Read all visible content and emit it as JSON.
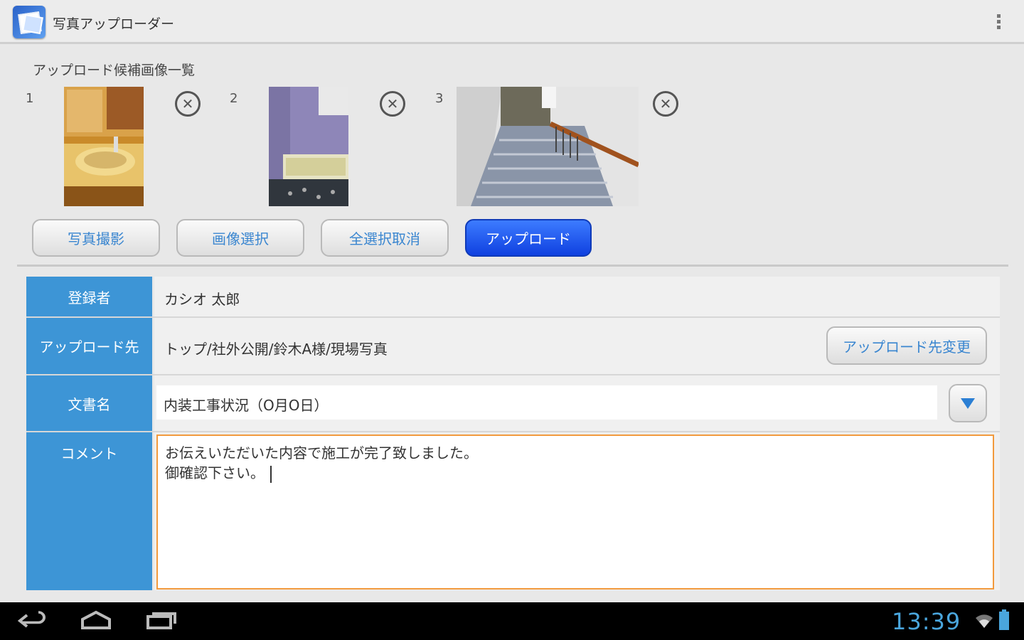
{
  "app": {
    "title": "写真アップローダー"
  },
  "candidates": {
    "label": "アップロード候補画像一覧",
    "items": [
      {
        "index": "1"
      },
      {
        "index": "2"
      },
      {
        "index": "3"
      }
    ]
  },
  "buttons": {
    "take_photo": "写真撮影",
    "select_image": "画像選択",
    "deselect_all": "全選択取消",
    "upload": "アップロード"
  },
  "form": {
    "registrant_label": "登録者",
    "registrant_value": "カシオ 太郎",
    "destination_label": "アップロード先",
    "destination_value": "トップ/社外公開/鈴木A様/現場写真",
    "change_destination": "アップロード先変更",
    "docname_label": "文書名",
    "docname_value": "内装工事状況（O月O日）",
    "comment_label": "コメント",
    "comment_line1": "お伝えいただいた内容で施工が完了致しました。",
    "comment_line2": "御確認下さい。"
  },
  "status": {
    "time": "13:39"
  },
  "colors": {
    "header_blue": "#3d95d6",
    "primary_button": "#1b4fe8",
    "focus_orange": "#f29a3d",
    "clock": "#4aa6dd"
  }
}
